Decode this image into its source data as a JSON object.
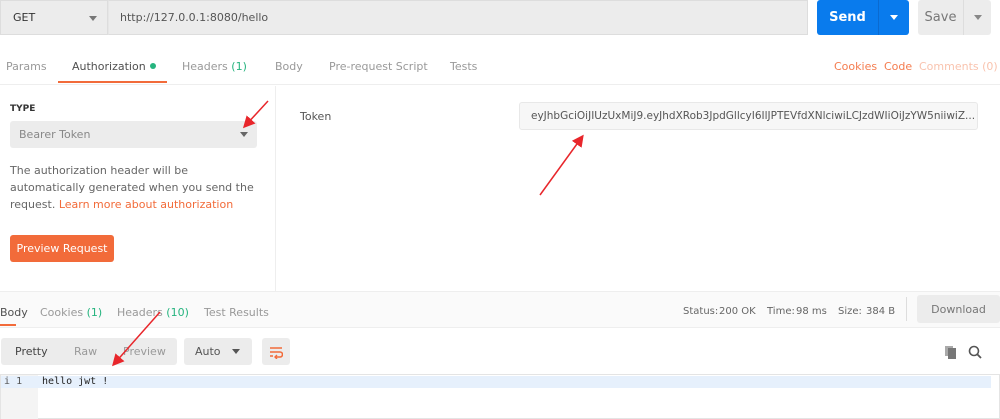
{
  "request": {
    "method": "GET",
    "url": "http://127.0.0.1:8080/hello",
    "send_label": "Send",
    "save_label": "Save"
  },
  "tabs": {
    "params": "Params",
    "authorization": "Authorization",
    "headers": "Headers",
    "headers_count": "(1)",
    "body": "Body",
    "prerequest": "Pre-request Script",
    "tests": "Tests"
  },
  "links": {
    "cookies": "Cookies",
    "code": "Code",
    "comments": "Comments (0)"
  },
  "auth": {
    "type_label": "TYPE",
    "type_value": "Bearer Token",
    "desc": "The authorization header will be automatically generated when you send the request. ",
    "learn_more": "Learn more about authorization",
    "preview_label": "Preview Request",
    "token_label": "Token",
    "token_value": "eyJhbGciOiJIUzUxMiJ9.eyJhdXRob3JpdGllcyI6IlJPTEVfdXNlciwiLCJzdWIiOiJzYW5niiwiZ..."
  },
  "response": {
    "tabs": {
      "body": "Body",
      "cookies": "Cookies",
      "cookies_count": "(1)",
      "headers": "Headers",
      "headers_count": "(10)",
      "test_results": "Test Results"
    },
    "status_label": "Status:",
    "status": "200 OK",
    "time_label": "Time:",
    "time": "98 ms",
    "size_label": "Size:",
    "size": "384 B",
    "download_label": "Download",
    "views": {
      "pretty": "Pretty",
      "raw": "Raw",
      "preview": "Preview"
    },
    "format": "Auto",
    "line_number": "1",
    "line_marker": "i",
    "body": "hello jwt !"
  },
  "colors": {
    "accent": "#f26b3a",
    "send": "#097bed",
    "success": "#26b47f",
    "annotation": "#e8262b"
  }
}
